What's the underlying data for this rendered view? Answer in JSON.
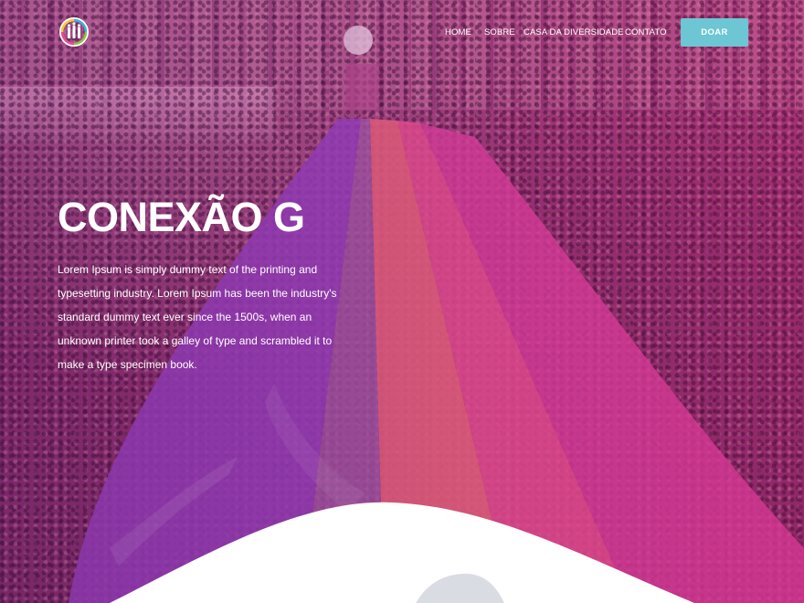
{
  "header": {
    "logo_icon": "people-rainbow-logo-icon",
    "nav": [
      {
        "label": "HOME"
      },
      {
        "label": "SOBRE"
      },
      {
        "label": "CASA DA DIVERSIDADE"
      },
      {
        "label": "CONTATO"
      }
    ],
    "donate_label": "DOAR"
  },
  "hero": {
    "title": "CONEXÃO G",
    "description": "Lorem Ipsum is simply dummy text of the printing and typesetting industry. Lorem Ipsum has been the industry's standard dummy text ever since the 1500s, when an unknown printer took a galley of type and scrambled it to make a type specimen book."
  },
  "colors": {
    "accent": "#6cc6d4",
    "overlay": "#9b2f7a",
    "text": "#ffffff",
    "background": "#ffffff"
  }
}
